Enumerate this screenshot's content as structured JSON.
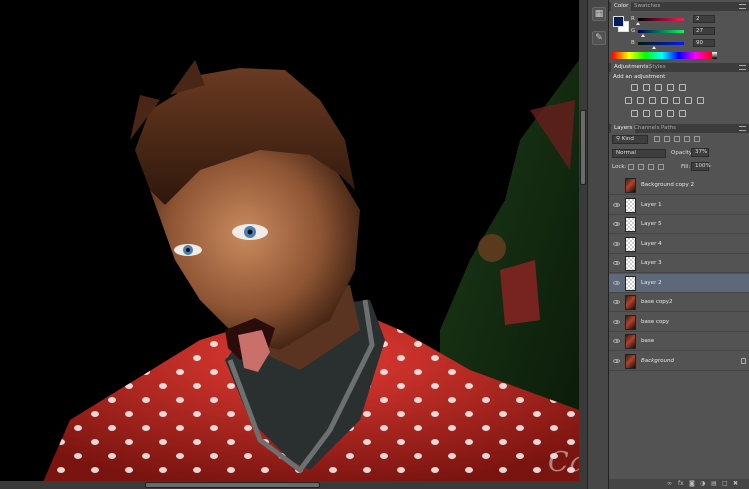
{
  "watermark": "CandyGirlSFM",
  "color_panel": {
    "tabs": [
      "Color",
      "Swatches"
    ],
    "channels": [
      {
        "label": "R",
        "value": "2",
        "gradient": [
          "#020000",
          "#ff1b5a"
        ]
      },
      {
        "label": "G",
        "value": "27",
        "gradient": [
          "#00005a",
          "#02ff5a"
        ]
      },
      {
        "label": "B",
        "value": "90",
        "gradient": [
          "#021b00",
          "#021bff"
        ]
      }
    ],
    "foreground_color": "#021b5a",
    "background_color": "#ffffff"
  },
  "adjustments_panel": {
    "tabs": [
      "Adjustments",
      "Styles"
    ],
    "title": "Add an adjustment",
    "icon_rows": [
      [
        "brightness-contrast-icon",
        "levels-icon",
        "curves-icon",
        "exposure-icon",
        "gradient-triangle-icon"
      ],
      [
        "vibrance-icon",
        "hue-saturation-icon",
        "color-balance-icon",
        "black-white-icon",
        "photo-filter-icon",
        "channel-mixer-icon",
        "color-lookup-icon"
      ],
      [
        "invert-icon",
        "posterize-icon",
        "threshold-icon",
        "selective-color-icon",
        "gradient-map-icon"
      ]
    ]
  },
  "layers_panel": {
    "tabs": [
      "Layers",
      "Channels",
      "Paths"
    ],
    "filter_kind": "Kind",
    "blend_mode": "Normal",
    "opacity_label": "Opacity:",
    "opacity": "37%",
    "lock_label": "Lock:",
    "fill_label": "Fill:",
    "fill": "100%",
    "layers": [
      {
        "name": "Background copy 2",
        "thumb": "photo",
        "visible": false,
        "selected": false,
        "locked": false,
        "italic": false
      },
      {
        "name": "Layer 1",
        "thumb": "trans",
        "visible": true,
        "selected": false,
        "locked": false,
        "italic": false
      },
      {
        "name": "Layer 5",
        "thumb": "trans",
        "visible": true,
        "selected": false,
        "locked": false,
        "italic": false
      },
      {
        "name": "Layer 4",
        "thumb": "trans",
        "visible": true,
        "selected": false,
        "locked": false,
        "italic": false
      },
      {
        "name": "Layer 3",
        "thumb": "trans",
        "visible": true,
        "selected": false,
        "locked": false,
        "italic": false
      },
      {
        "name": "Layer 2",
        "thumb": "trans",
        "visible": true,
        "selected": true,
        "locked": false,
        "italic": false
      },
      {
        "name": "base copy2",
        "thumb": "photo",
        "visible": true,
        "selected": false,
        "locked": false,
        "italic": false
      },
      {
        "name": "base copy",
        "thumb": "photo",
        "visible": true,
        "selected": false,
        "locked": false,
        "italic": false
      },
      {
        "name": "base",
        "thumb": "photo",
        "visible": true,
        "selected": false,
        "locked": false,
        "italic": false
      },
      {
        "name": "Background",
        "thumb": "photo",
        "visible": true,
        "selected": false,
        "locked": true,
        "italic": true
      }
    ],
    "footer_icons": [
      "link-icon",
      "fx-icon",
      "mask-icon",
      "adjustment-layer-icon",
      "group-folder-icon",
      "new-layer-icon",
      "trash-icon"
    ]
  }
}
